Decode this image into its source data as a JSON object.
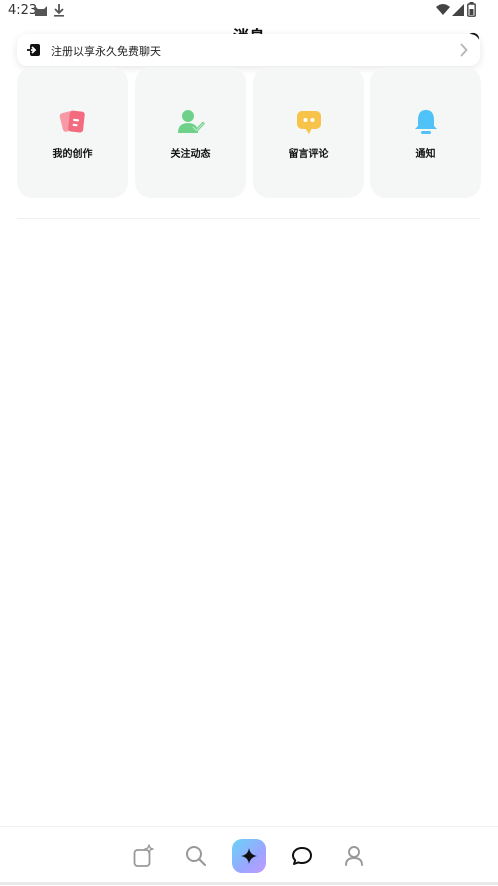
{
  "status_bar": {
    "time": "4:23",
    "icons": [
      "cat-notification-icon",
      "download-icon",
      "wifi-icon",
      "signal-icon",
      "battery-icon"
    ]
  },
  "header": {
    "title": "消息"
  },
  "banner": {
    "text": "注册以享永久免费聊天",
    "icon": "login-icon"
  },
  "tiles": [
    {
      "label": "我的创作",
      "icon": "creations-icon",
      "color": "#f36b7f"
    },
    {
      "label": "关注动态",
      "icon": "follow-user-icon",
      "color": "#6fd08a"
    },
    {
      "label": "留言评论",
      "icon": "comment-bubble-icon",
      "color": "#f8c34a"
    },
    {
      "label": "通知",
      "icon": "bell-icon",
      "color": "#4fc3f7"
    }
  ],
  "bottom_nav": [
    {
      "name": "create",
      "icon": "edit-sparkle-icon"
    },
    {
      "name": "search",
      "icon": "search-icon"
    },
    {
      "name": "ai",
      "icon": "sparkle-icon"
    },
    {
      "name": "messages",
      "icon": "chat-icon"
    },
    {
      "name": "profile",
      "icon": "user-icon"
    }
  ]
}
